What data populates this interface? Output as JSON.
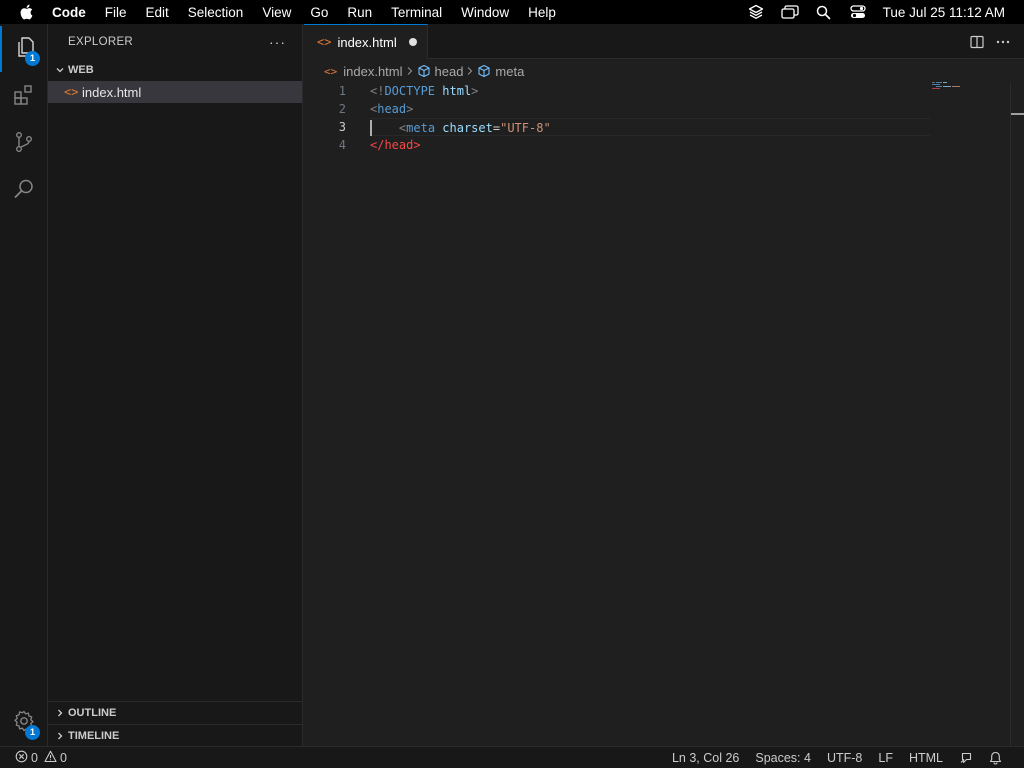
{
  "menubar": {
    "app_name": "Code",
    "items": [
      "File",
      "Edit",
      "Selection",
      "View",
      "Go",
      "Run",
      "Terminal",
      "Window",
      "Help"
    ],
    "clock": "Tue Jul 25  11:12 AM"
  },
  "activitybar": {
    "explorer_badge": "1",
    "settings_badge": "1"
  },
  "sidebar": {
    "title": "EXPLORER",
    "more": "···",
    "folder": "WEB",
    "files": [
      {
        "name": "index.html",
        "icon": "<>"
      }
    ],
    "outline": "OUTLINE",
    "timeline": "TIMELINE"
  },
  "tabs": [
    {
      "label": "index.html",
      "icon": "<>",
      "modified": true
    }
  ],
  "breadcrumb": {
    "file": "index.html",
    "items": [
      "head",
      "meta"
    ]
  },
  "editor": {
    "line_numbers": [
      "1",
      "2",
      "3",
      "4"
    ],
    "current_line": 3,
    "lines": [
      {
        "indent": "",
        "parts": [
          [
            "punc",
            "<!"
          ],
          [
            "tag",
            "DOCTYPE"
          ],
          [
            "plain",
            " "
          ],
          [
            "attr",
            "html"
          ],
          [
            "punc",
            ">"
          ]
        ]
      },
      {
        "indent": "",
        "parts": [
          [
            "punc",
            "<"
          ],
          [
            "tag",
            "head"
          ],
          [
            "punc",
            ">"
          ]
        ]
      },
      {
        "indent": "    ",
        "parts": [
          [
            "punc",
            "<"
          ],
          [
            "tag",
            "meta"
          ],
          [
            "plain",
            " "
          ],
          [
            "attr",
            "charset"
          ],
          [
            "plain",
            "="
          ],
          [
            "str",
            "\"UTF-8\""
          ]
        ]
      },
      {
        "indent": "",
        "parts": [
          [
            "close",
            "</head>"
          ]
        ]
      }
    ]
  },
  "statusbar": {
    "errors": "0",
    "warnings": "0",
    "position": "Ln 3, Col 26",
    "spaces": "Spaces: 4",
    "encoding": "UTF-8",
    "eol": "LF",
    "language": "HTML"
  },
  "colors": {
    "accent": "#0078d4",
    "html_icon": "#e37933"
  }
}
